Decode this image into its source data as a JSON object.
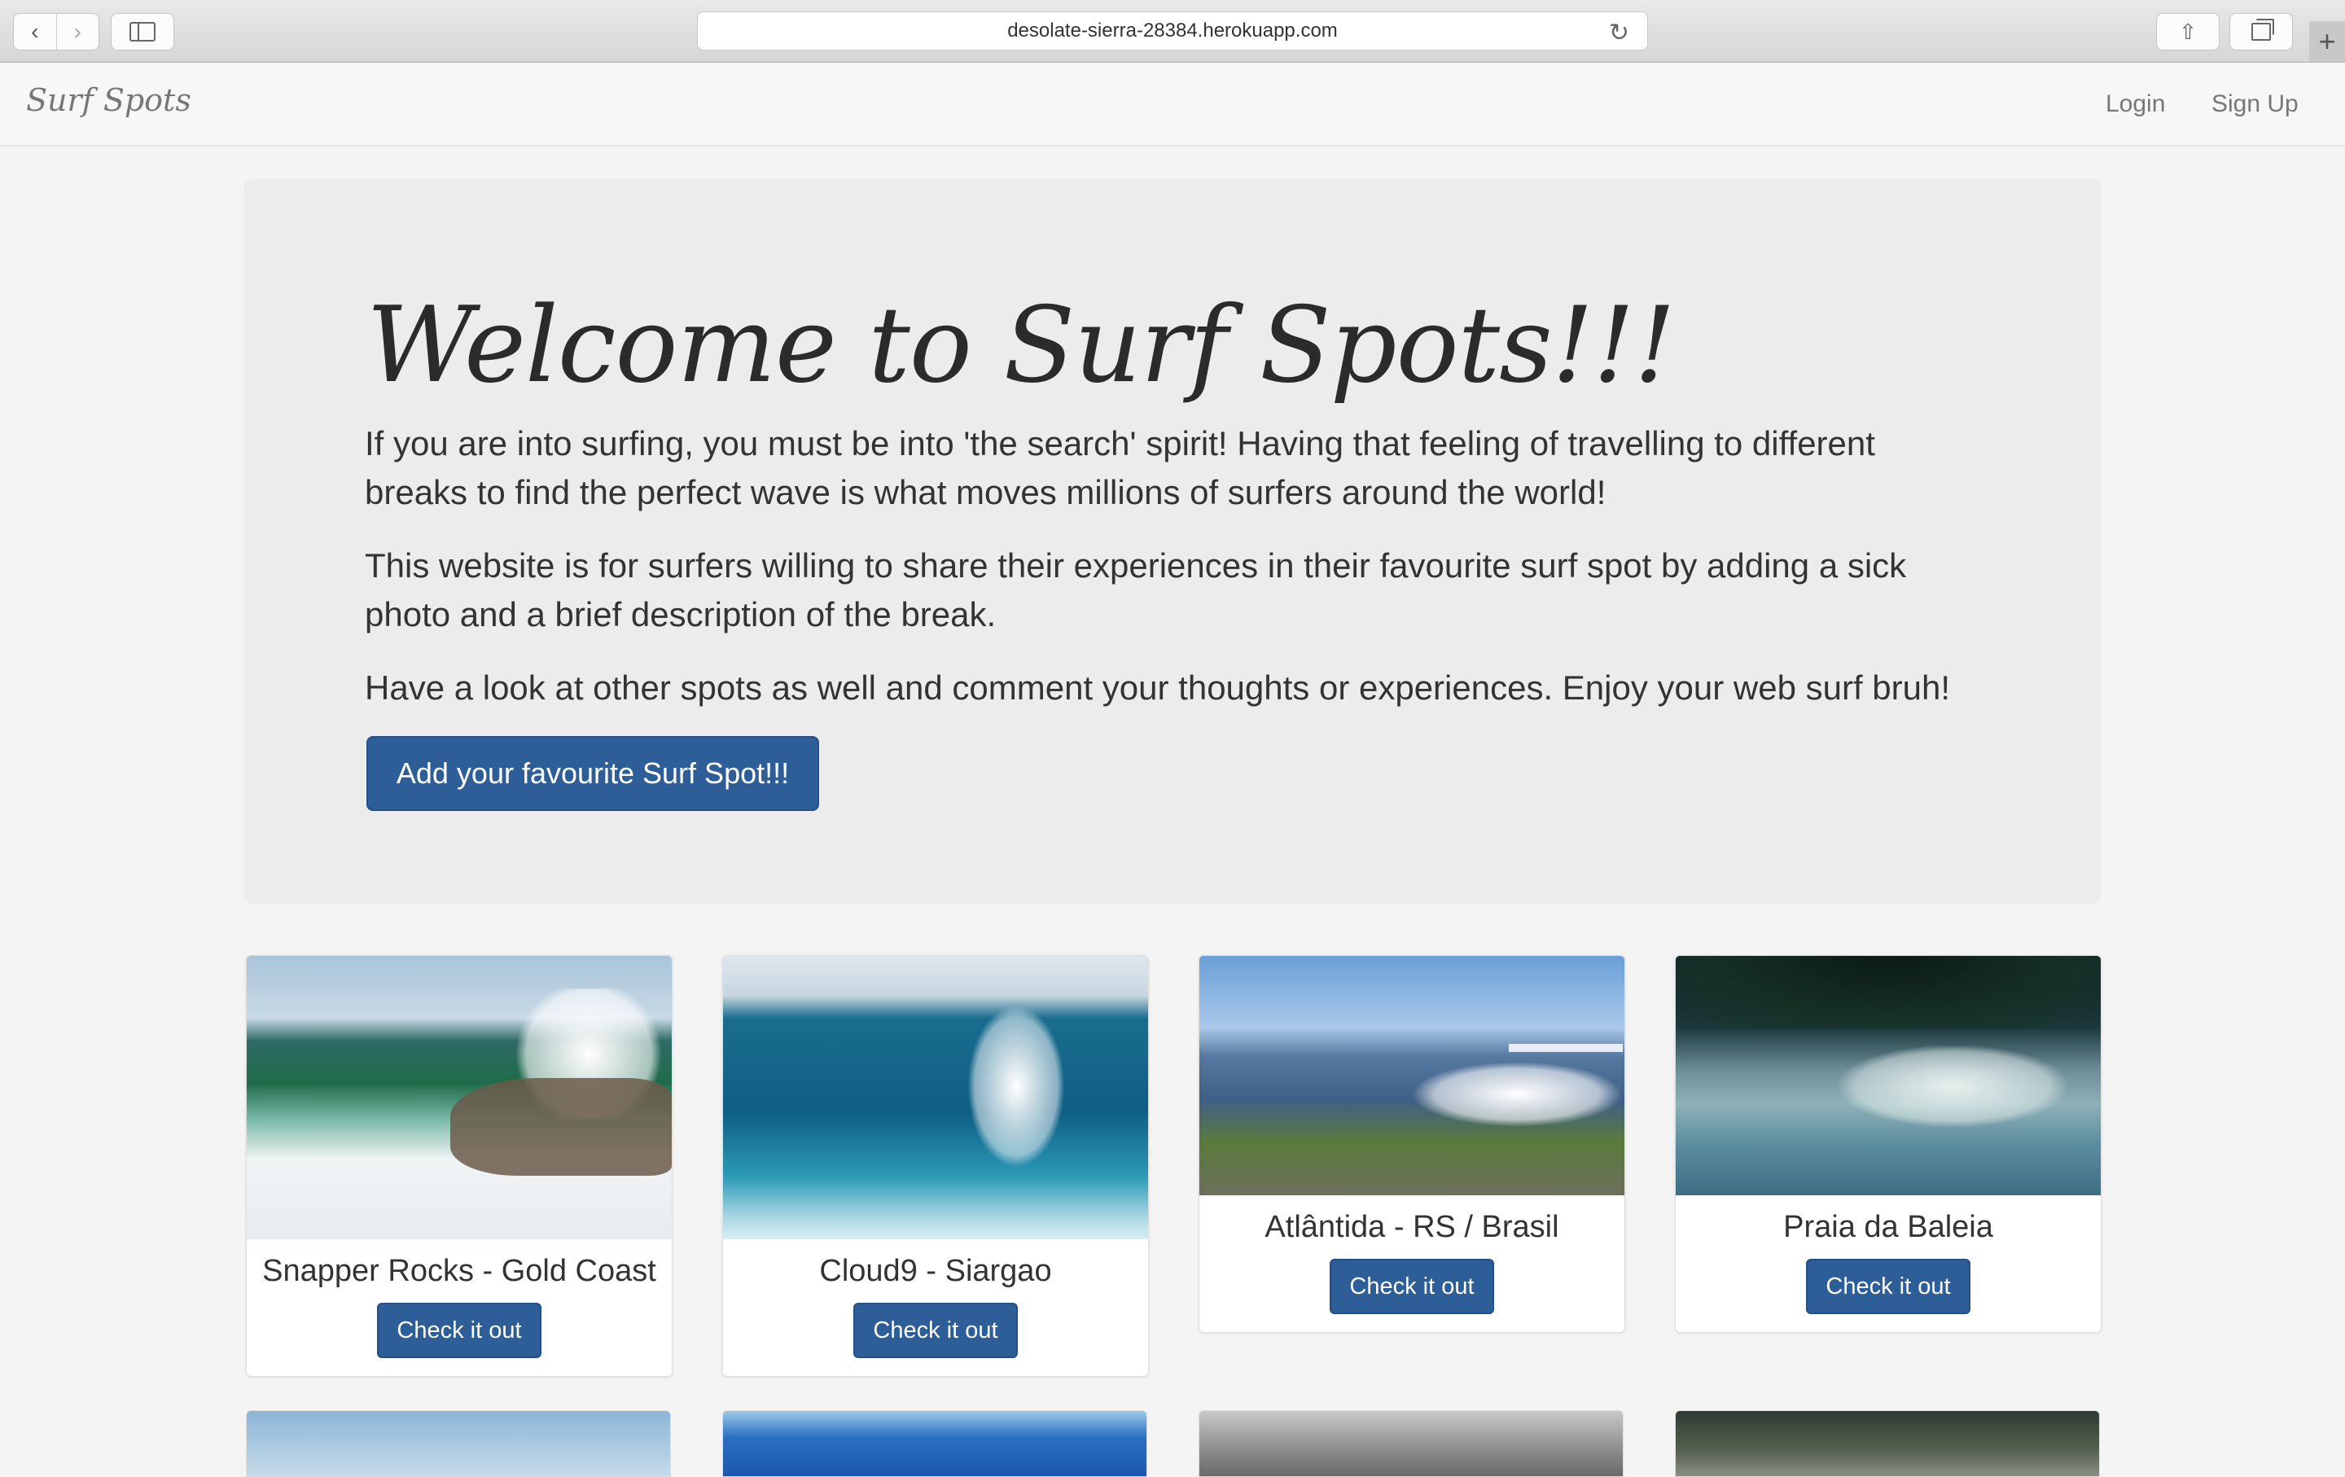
{
  "browser": {
    "url": "desolate-sierra-28384.herokuapp.com",
    "back_glyph": "‹",
    "forward_glyph": "›",
    "reload_glyph": "↻",
    "share_glyph": "⇧",
    "newtab_glyph": "+"
  },
  "navbar": {
    "brand": "Surf Spots",
    "login": "Login",
    "signup": "Sign Up"
  },
  "hero": {
    "title": "Welcome to Surf Spots!!!",
    "paragraph_1": "If you are into surfing, you must be into 'the search' spirit! Having that feeling of travelling to different breaks to find the perfect wave is what moves millions of surfers around the world!",
    "paragraph_2": "This website is for surfers willing to share their experiences in their favourite surf spot by adding a sick photo and a brief description of the break.",
    "paragraph_3": "Have a look at other spots as well and comment your thoughts or experiences. Enjoy your web surf bruh!",
    "cta": "Add your favourite Surf Spot!!!"
  },
  "spots": [
    {
      "name": "Snapper Rocks - Gold Coast",
      "button": "Check it out"
    },
    {
      "name": "Cloud9 - Siargao",
      "button": "Check it out"
    },
    {
      "name": "Atlântida - RS / Brasil",
      "button": "Check it out"
    },
    {
      "name": "Praia da Baleia",
      "button": "Check it out"
    }
  ],
  "icons": {
    "back": "chevron-left-icon",
    "forward": "chevron-right-icon",
    "sidebar": "sidebar-icon",
    "reload": "reload-icon",
    "share": "share-icon",
    "tabs": "tabs-overview-icon",
    "new_tab": "plus-icon"
  },
  "colors": {
    "primary_button": "#2e5e97",
    "jumbotron_bg": "#ececec",
    "page_bg": "#f4f4f4"
  }
}
